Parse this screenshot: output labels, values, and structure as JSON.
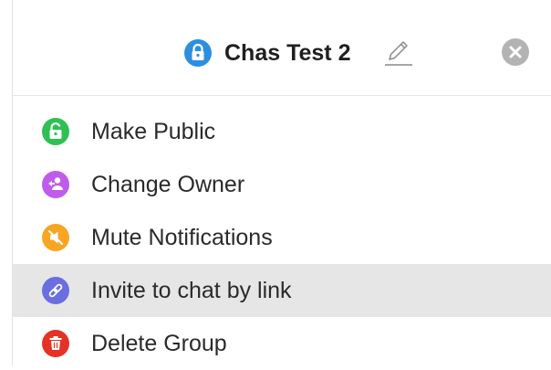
{
  "header": {
    "title": "Chas Test 2",
    "lock_icon": "lock-icon",
    "lock_color": "#2c8fe0",
    "edit_icon": "pencil-icon",
    "close_icon": "close-icon",
    "close_color": "#b3b3b3"
  },
  "menu": {
    "items": [
      {
        "label": "Make Public",
        "icon": "unlock-icon",
        "color": "#2fbf55",
        "highlighted": false
      },
      {
        "label": "Change Owner",
        "icon": "user-swap-icon",
        "color": "#c05bea",
        "highlighted": false
      },
      {
        "label": "Mute Notifications",
        "icon": "mute-icon",
        "color": "#f6a623",
        "highlighted": false
      },
      {
        "label": "Invite to chat by link",
        "icon": "link-icon",
        "color": "#6a6ee0",
        "highlighted": true
      },
      {
        "label": "Delete Group",
        "icon": "trash-icon",
        "color": "#e53224",
        "highlighted": false
      }
    ]
  }
}
